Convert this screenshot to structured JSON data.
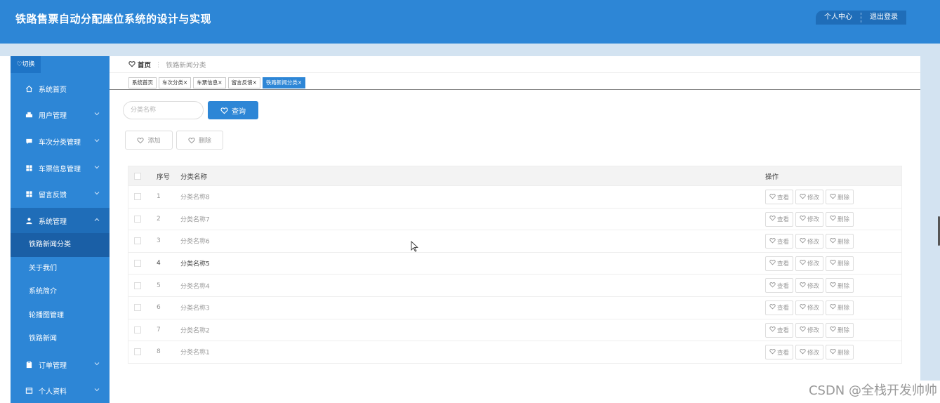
{
  "header": {
    "title": "铁路售票自动分配座位系统的设计与实现",
    "user_center": "个人中心",
    "logout": "退出登录"
  },
  "sidebar": {
    "switch_label": "♡切换",
    "items": [
      {
        "label": "系统首页",
        "icon": "home-icon"
      },
      {
        "label": "用户管理",
        "icon": "user-group-icon"
      },
      {
        "label": "车次分类管理",
        "icon": "message-icon"
      },
      {
        "label": "车票信息管理",
        "icon": "grid-icon"
      },
      {
        "label": "留言反馈",
        "icon": "grid-icon"
      },
      {
        "label": "系统管理",
        "icon": "person-icon"
      }
    ],
    "sub_items": [
      "铁路新闻分类",
      "关于我们",
      "系统简介",
      "轮播图管理",
      "铁路新闻"
    ],
    "bottom_items": [
      {
        "label": "订单管理",
        "icon": "clipboard-icon"
      },
      {
        "label": "个人资料",
        "icon": "card-icon"
      }
    ]
  },
  "breadcrumb": {
    "home": "首页",
    "separator": "⋮",
    "current": "铁路新闻分类"
  },
  "tabs": [
    "系统首页",
    "车次分类×",
    "车票信息×",
    "留言反馈×",
    "铁路新闻分类×"
  ],
  "search": {
    "placeholder": "分类名称",
    "button": "查询"
  },
  "actions": {
    "add": "添加",
    "delete": "删除"
  },
  "table": {
    "headers": {
      "index": "序号",
      "name": "分类名称",
      "ops": "操作"
    },
    "rows": [
      {
        "index": "1",
        "name": "分类名称8"
      },
      {
        "index": "2",
        "name": "分类名称7"
      },
      {
        "index": "3",
        "name": "分类名称6"
      },
      {
        "index": "4",
        "name": "分类名称5"
      },
      {
        "index": "5",
        "name": "分类名称4"
      },
      {
        "index": "6",
        "name": "分类名称3"
      },
      {
        "index": "7",
        "name": "分类名称2"
      },
      {
        "index": "8",
        "name": "分类名称1"
      }
    ],
    "row_ops": {
      "view": "查看",
      "edit": "修改",
      "delete": "删除"
    }
  },
  "watermark": "CSDN @全栈开发帅帅",
  "colors": {
    "primary": "#2d86d6",
    "dark": "#1f6db8",
    "band": "#d3e3f1"
  }
}
